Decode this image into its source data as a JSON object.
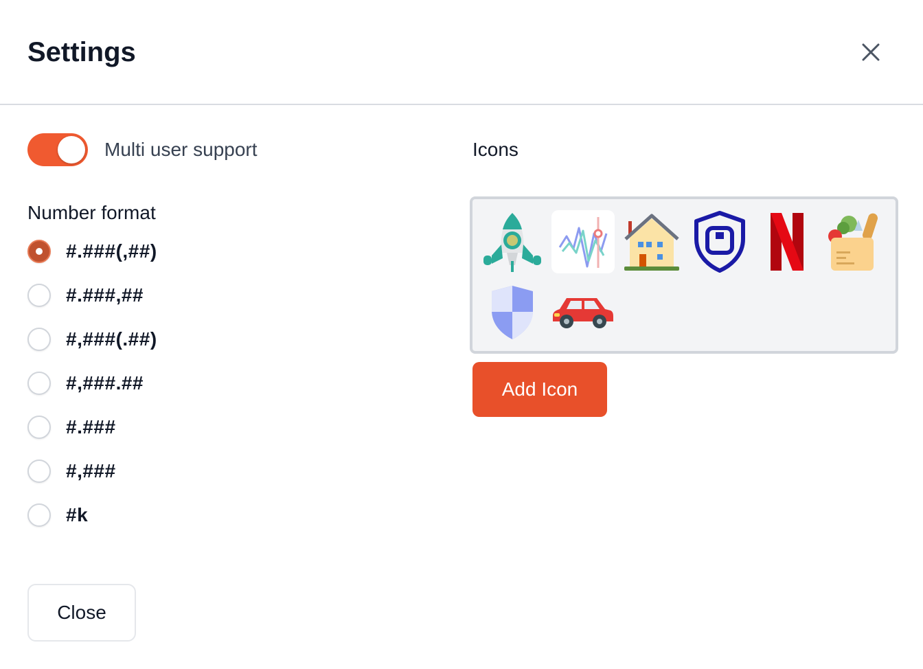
{
  "modal": {
    "title": "Settings",
    "close_icon": "close-icon"
  },
  "multi_user": {
    "label": "Multi user support",
    "enabled": true,
    "color": "#f05a30"
  },
  "number_format": {
    "title": "Number format",
    "selected": "#.###(,##)",
    "options": [
      "#.###(,##)",
      "#.###,##",
      "#,###(.##)",
      "#,###.##",
      "#.###",
      "#,###",
      "#k"
    ]
  },
  "icons": {
    "title": "Icons",
    "items": [
      "rocket-icon",
      "chart-line-icon",
      "house-icon",
      "shield-square-icon",
      "netflix-logo-icon",
      "grocery-bag-icon",
      "shield-icon",
      "car-icon"
    ],
    "add_label": "Add Icon",
    "accent": "#e8502a"
  },
  "footer": {
    "close_label": "Close"
  }
}
